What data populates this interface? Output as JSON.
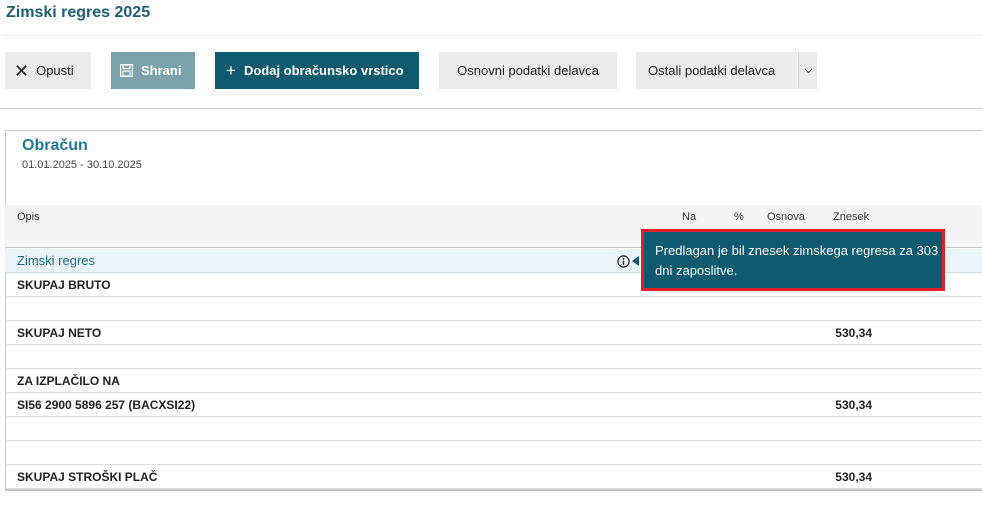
{
  "header": {
    "title": "Zimski regres 2025"
  },
  "toolbar": {
    "cancel_label": "Opusti",
    "save_label": "Shrani",
    "add_label": "Dodaj obračunsko vrstico",
    "basic_label": "Osnovni podatki delavca",
    "other_label": "Ostali podatki delavca"
  },
  "section": {
    "title": "Obračun",
    "period": "01.01.2025 - 30.10.2025"
  },
  "table": {
    "columns": {
      "desc": "Opis",
      "na": "Na",
      "pct": "%",
      "base": "Osnova",
      "amount": "Znesek"
    },
    "rows": [
      {
        "desc": "Zimski regres",
        "amount": ""
      },
      {
        "desc": "SKUPAJ BRUTO",
        "amount": ""
      },
      {
        "desc": "",
        "amount": ""
      },
      {
        "desc": "SKUPAJ NETO",
        "amount": "530,34"
      },
      {
        "desc": "",
        "amount": ""
      },
      {
        "desc": "ZA IZPLAČILO NA",
        "amount": ""
      },
      {
        "desc": "SI56 2900 5896 257 (BACXSI22)",
        "amount": "530,34"
      },
      {
        "desc": "",
        "amount": ""
      },
      {
        "desc": "",
        "amount": ""
      },
      {
        "desc": "SKUPAJ STROŠKI PLAČ",
        "amount": "530,34"
      }
    ]
  },
  "tooltip": {
    "text": "Predlagan je bil znesek zimskega regresa za 303 dni zaposlitve."
  },
  "colors": {
    "primary": "#0f5a6f",
    "accent_title": "#1d7a99",
    "highlight_border": "#e0212b"
  }
}
